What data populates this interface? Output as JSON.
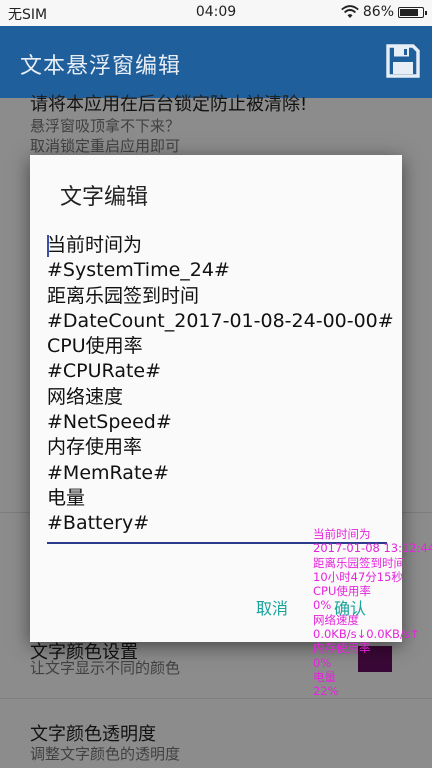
{
  "status_bar": {
    "carrier": "无SIM",
    "time": "04:09",
    "battery": "86%",
    "battery_level": 0.86
  },
  "app_bar": {
    "title": "文本悬浮窗编辑",
    "save_icon": "save-icon"
  },
  "background": {
    "partial_heading": "请将本应用在后台锁定防止被清除!",
    "hint_line1": "悬浮窗吸顶拿不下来？",
    "hint_line2": "取消锁定重启应用即可",
    "color_setting": {
      "title": "文字颜色设置",
      "subtitle": "让文字显示不同的颜色"
    },
    "alpha_setting": {
      "title": "文字颜色透明度",
      "subtitle": "调整文字颜色的透明度"
    },
    "accent_color": "#6a0f63"
  },
  "dialog": {
    "title": "文字编辑",
    "lines": [
      "当前时间为",
      "#SystemTime_24#",
      "距离乐园签到时间",
      "#DateCount_2017-01-08-24-00-00#",
      "CPU使用率",
      "#CPURate#",
      "网络速度",
      "#NetSpeed#",
      "内存使用率",
      "#MemRate#",
      "电量",
      "#Battery#"
    ],
    "cancel_label": "取消",
    "confirm_label": "确认",
    "button_color": "#19a39b"
  },
  "floating_window": {
    "color": "#e524dc",
    "lines": [
      "当前时间为",
      "2017-01-08 13:12:44",
      "距离乐园签到时间",
      "10小时47分15秒",
      "CPU使用率",
      "0%",
      "网络速度",
      "0.0KB/s↓0.0KB/s↑",
      "内存使用率",
      "0%",
      "电量",
      "22%"
    ]
  }
}
